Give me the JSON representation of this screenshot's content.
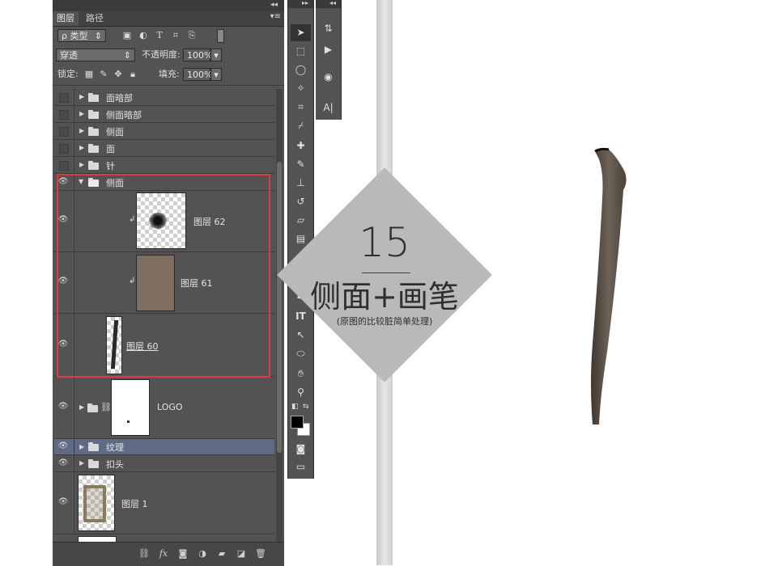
{
  "panel": {
    "tabs": [
      "图层",
      "路径"
    ],
    "filter_label": "ρ 类型",
    "blend_mode": "穿透",
    "opacity_label": "不透明度:",
    "opacity_value": "100%",
    "lock_label": "锁定:",
    "fill_label": "填充:",
    "fill_value": "100%"
  },
  "layers": {
    "g1": "面暗部",
    "g2": "侧面暗部",
    "g3": "侧面",
    "g4": "面",
    "g5": "针",
    "g6": "侧面",
    "l62": "图层 62",
    "l61": "图层 61",
    "l60": "图层 60",
    "logo": "LOGO",
    "texture": "纹理",
    "buckle": "扣头",
    "l1": "图层 1"
  },
  "bottom_icons": [
    "link-icon",
    "fx-icon",
    "mask-icon",
    "adjustment-icon",
    "group-icon",
    "new-layer-icon",
    "trash-icon"
  ],
  "tools": {
    "type_tool": "IT"
  },
  "overlay": {
    "number": "15",
    "title": "侧面+画笔",
    "subtitle": "(原图的比较脏简单处理)"
  },
  "colors": {
    "panel_bg": "#535353",
    "selected_row": "#5f6b85",
    "highlight_box": "#e23a3a",
    "diamond": "#b9b9b9",
    "strap": "#5e534a"
  }
}
